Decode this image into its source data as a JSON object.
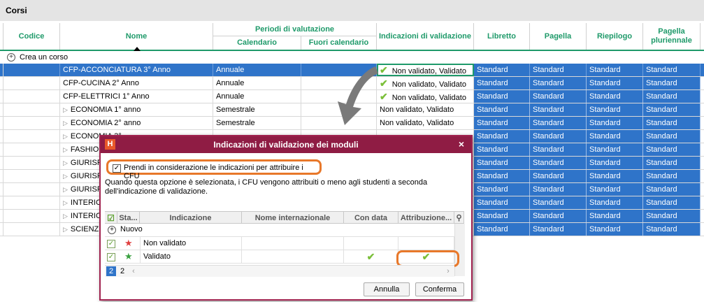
{
  "window_title": "Corsi",
  "headers": {
    "codice": "Codice",
    "nome": "Nome",
    "periodi_group": "Periodi di valutazione",
    "calendario": "Calendario",
    "fuori_calendario": "Fuori calendario",
    "indicazioni": "Indicazioni di validazione",
    "libretto": "Libretto",
    "pagella": "Pagella",
    "riepilogo": "Riepilogo",
    "pagella_pluriennale": "Pagella pluriennale"
  },
  "create_label": "Crea un corso",
  "rows": [
    {
      "nome": "CFP-ACCONCIATURA 3° Anno",
      "cal": "Annuale",
      "valid": "Non validato, Validato",
      "lib": "Standard",
      "pag": "Standard",
      "rie": "Standard",
      "plu": "Standard"
    },
    {
      "nome": "CFP-CUCINA 2° Anno",
      "cal": "Annuale",
      "valid": "Non validato, Validato",
      "lib": "Standard",
      "pag": "Standard",
      "rie": "Standard",
      "plu": "Standard"
    },
    {
      "nome": "CFP-ELETTRICI 1° Anno",
      "cal": "Annuale",
      "valid": "Non validato, Validato",
      "lib": "Standard",
      "pag": "Standard",
      "rie": "Standard",
      "plu": "Standard"
    },
    {
      "nome": "ECONOMIA  1° anno",
      "cal": "Semestrale",
      "valid": "Non validato, Validato",
      "lib": "Standard",
      "pag": "Standard",
      "rie": "Standard",
      "plu": "Standard"
    },
    {
      "nome": "ECONOMIA  2° anno",
      "cal": "Semestrale",
      "valid": "Non validato, Validato",
      "lib": "Standard",
      "pag": "Standard",
      "rie": "Standard",
      "plu": "Standard"
    },
    {
      "nome": "ECONOMIA  3°",
      "lib": "Standard",
      "pag": "Standard",
      "rie": "Standard",
      "plu": "Standard"
    },
    {
      "nome": "FASHIO",
      "lib": "Standard",
      "pag": "Standard",
      "rie": "Standard",
      "plu": "Standard"
    },
    {
      "nome": "GIURISP",
      "lib": "Standard",
      "pag": "Standard",
      "rie": "Standard",
      "plu": "Standard"
    },
    {
      "nome": "GIURISP",
      "lib": "Standard",
      "pag": "Standard",
      "rie": "Standard",
      "plu": "Standard"
    },
    {
      "nome": "GIURISP",
      "lib": "Standard",
      "pag": "Standard",
      "rie": "Standard",
      "plu": "Standard"
    },
    {
      "nome": "INTERIO",
      "lib": "Standard",
      "pag": "Standard",
      "rie": "Standard",
      "plu": "Standard"
    },
    {
      "nome": "INTERIO",
      "lib": "Standard",
      "pag": "Standard",
      "rie": "Standard",
      "plu": "Standard"
    },
    {
      "nome": "SCIENZE D",
      "lib": "Standard",
      "pag": "Standard",
      "rie": "Standard",
      "plu": "Standard"
    }
  ],
  "dialog": {
    "title": "Indicazioni di validazione dei moduli",
    "logo": "H",
    "close": "×",
    "option_label": "Prendi in considerazione le indicazioni per attribuire i CFU",
    "description": "Quando questa opzione è selezionata, i CFU vengono attribuiti o meno agli studenti a seconda dell'indicazione di validazione.",
    "table_headers": {
      "sta": "Sta...",
      "indicazione": "Indicazione",
      "nome_int": "Nome internazionale",
      "con_data": "Con data",
      "attribuzione": "Attribuzione..."
    },
    "new_label": "Nuovo",
    "items": [
      {
        "label": "Non validato",
        "star_color": "#e04040"
      },
      {
        "label": "Validato",
        "star_color": "#3aa040"
      }
    ],
    "pages": [
      "2",
      "2"
    ],
    "annulla": "Annulla",
    "conferma": "Conferma"
  },
  "colors": {
    "accent_green": "#1f9a6a",
    "selection_blue": "#2f74c9",
    "dialog_red": "#8f1c44",
    "highlight_orange": "#e8782a"
  }
}
